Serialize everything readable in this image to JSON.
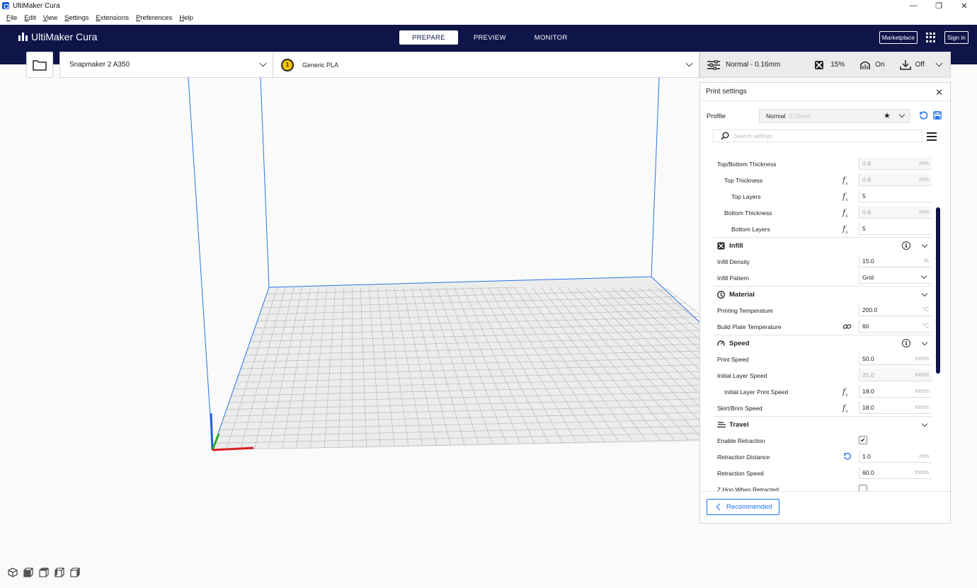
{
  "window": {
    "title": "UltiMaker Cura"
  },
  "menu": [
    "File",
    "Edit",
    "View",
    "Settings",
    "Extensions",
    "Preferences",
    "Help"
  ],
  "header": {
    "logo": "UltiMaker Cura",
    "stages": [
      "PREPARE",
      "PREVIEW",
      "MONITOR"
    ],
    "active_stage": "PREPARE",
    "marketplace": "Marketplace",
    "signin": "Sign in"
  },
  "toolbar": {
    "printer": "Snapmaker 2 A350",
    "extruder_number": "1",
    "material": "Generic PLA",
    "profile_summary": "Normal - 0.16mm",
    "infill": "15%",
    "support": "On",
    "adhesion": "Off"
  },
  "panel": {
    "title": "Print settings",
    "profile_label": "Profile",
    "profile_name": "Normal",
    "profile_layer": "0.16mm",
    "search_placeholder": "Search settings",
    "rows": [
      {
        "type": "setting",
        "level": 0,
        "label": "Top/Bottom Thickness",
        "value": "0.8",
        "unit": "mm",
        "disabled": true
      },
      {
        "type": "setting",
        "level": 1,
        "label": "Top Thickness",
        "value": "0.8",
        "unit": "mm",
        "disabled": true,
        "fx": true
      },
      {
        "type": "setting",
        "level": 2,
        "label": "Top Layers",
        "value": "5",
        "unit": "",
        "fx": true
      },
      {
        "type": "setting",
        "level": 1,
        "label": "Bottom Thickness",
        "value": "0.8",
        "unit": "mm",
        "disabled": true,
        "fx": true
      },
      {
        "type": "setting",
        "level": 2,
        "label": "Bottom Layers",
        "value": "5",
        "unit": "",
        "fx": true
      },
      {
        "type": "category",
        "label": "Infill",
        "icon": "infill-icon",
        "info": true
      },
      {
        "type": "setting",
        "level": 0,
        "label": "Infill Density",
        "value": "15.0",
        "unit": "%"
      },
      {
        "type": "select",
        "level": 0,
        "label": "Infill Pattern",
        "value": "Grid"
      },
      {
        "type": "category",
        "label": "Material",
        "icon": "material-icon"
      },
      {
        "type": "setting",
        "level": 0,
        "label": "Printing Temperature",
        "value": "200.0",
        "unit": "°C"
      },
      {
        "type": "setting",
        "level": 0,
        "label": "Build Plate Temperature",
        "value": "60",
        "unit": "°C",
        "link": true
      },
      {
        "type": "category",
        "label": "Speed",
        "icon": "speed-icon",
        "info": true
      },
      {
        "type": "setting",
        "level": 0,
        "label": "Print Speed",
        "value": "50.0",
        "unit": "mm/s"
      },
      {
        "type": "setting",
        "level": 0,
        "label": "Initial Layer Speed",
        "value": "25.0",
        "unit": "mm/s",
        "disabled": true
      },
      {
        "type": "setting",
        "level": 1,
        "label": "Initial Layer Print Speed",
        "value": "18.0",
        "unit": "mm/s",
        "fx": true
      },
      {
        "type": "setting",
        "level": 0,
        "label": "Skirt/Brim Speed",
        "value": "18.0",
        "unit": "mm/s",
        "fx": true
      },
      {
        "type": "category",
        "label": "Travel",
        "icon": "travel-icon"
      },
      {
        "type": "checkbox",
        "level": 0,
        "label": "Enable Retraction",
        "checked": true
      },
      {
        "type": "setting",
        "level": 0,
        "label": "Retraction Distance",
        "value": "1.0",
        "unit": "mm",
        "reset": true,
        "italic": true
      },
      {
        "type": "setting",
        "level": 0,
        "label": "Retraction Speed",
        "value": "60.0",
        "unit": "mm/s"
      },
      {
        "type": "checkbox",
        "level": 0,
        "label": "Z Hop When Retracted",
        "checked": false
      }
    ],
    "recommended": "Recommended"
  },
  "colors": {
    "header_bg": "#0f1449",
    "accent": "#196ef0",
    "extruder": "#f3c300"
  }
}
